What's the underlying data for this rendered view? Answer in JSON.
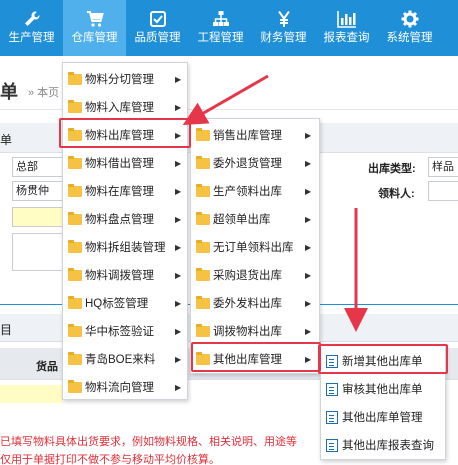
{
  "nav": {
    "items": [
      {
        "label": "生产管理",
        "icon": "wrench-icon"
      },
      {
        "label": "仓库管理",
        "icon": "cart-icon"
      },
      {
        "label": "品质管理",
        "icon": "checkbox-icon"
      },
      {
        "label": "工程管理",
        "icon": "sitemap-icon"
      },
      {
        "label": "财务管理",
        "icon": "yen-icon"
      },
      {
        "label": "报表查询",
        "icon": "bar-chart-icon"
      },
      {
        "label": "系统管理",
        "icon": "gear-icon"
      }
    ],
    "active_index": 1,
    "colors": {
      "bar": "#1f8fd8",
      "active": "#4fb0ec"
    }
  },
  "page": {
    "title": "单",
    "breadcrumb": "» 本页",
    "fields": {
      "dept_value": "总部",
      "person_value": "杨贯仲",
      "outbound_type_label": "出库类型:",
      "outbound_type_value": "样品",
      "receiver_label": "领料人:",
      "goods_label": "货品",
      "tab_char": "目",
      "row_char": "单"
    },
    "notes": [
      "已填写物料具体出货要求，例如物料规格、相关说明、用途等",
      "仅用于单据打印不做不参与移动平均价核算。"
    ]
  },
  "menu_level1": [
    "物料分切管理",
    "物料入库管理",
    "物料出库管理",
    "物料借出管理",
    "物料在库管理",
    "物料盘点管理",
    "物料拆组装管理",
    "物料调拨管理",
    "HQ标签管理",
    "华中标签验证",
    "青岛BOE来料",
    "物料流向管理"
  ],
  "menu_level2": [
    "销售出库管理",
    "委外退货管理",
    "生产领料出库",
    "超领单出库",
    "无订单领料出库",
    "采购退货出库",
    "委外发料出库",
    "调拨物料出库",
    "其他出库管理"
  ],
  "menu_level3": [
    "新增其他出库单",
    "审核其他出库单",
    "其他出库单管理",
    "其他出库报表查询"
  ],
  "highlight_color": "#e6374a"
}
